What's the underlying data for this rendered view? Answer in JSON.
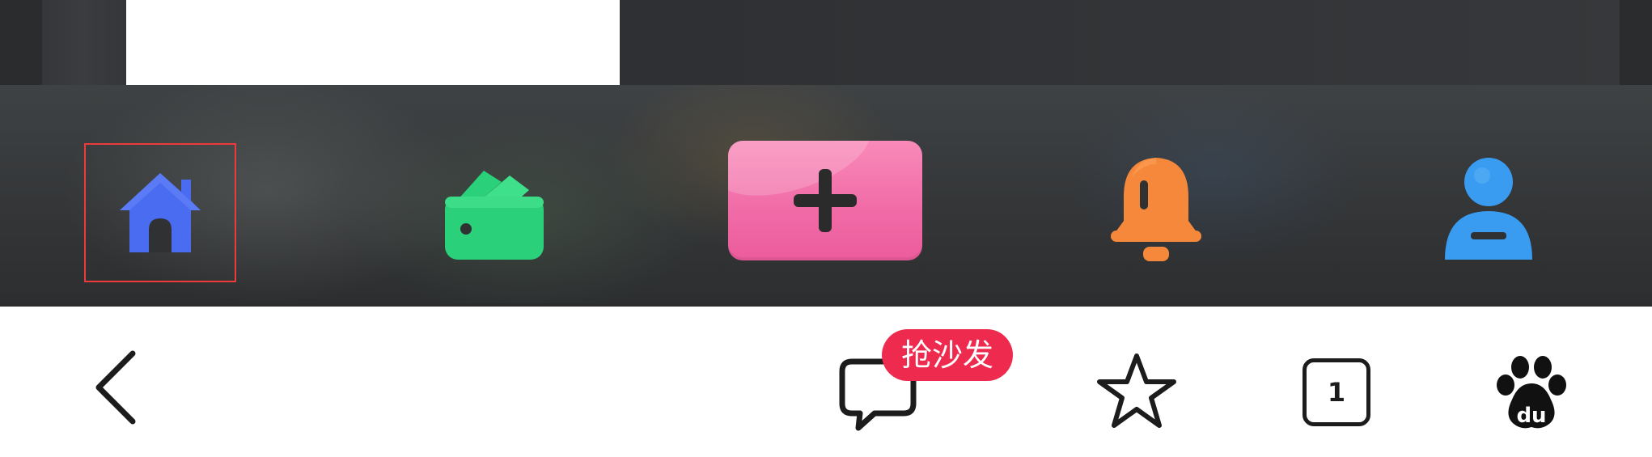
{
  "colors": {
    "home_icon": "#4a6cf0",
    "wallet_icon": "#2bd07a",
    "add_button": "#f06aa6",
    "bell_icon": "#f5883a",
    "user_icon": "#3a9cf0",
    "selection_box": "#ee3a3a",
    "badge": "#ee2b4e"
  },
  "tabbar": {
    "items": [
      {
        "icon": "home-icon"
      },
      {
        "icon": "wallet-icon"
      },
      {
        "icon": "plus-icon"
      },
      {
        "icon": "bell-icon"
      },
      {
        "icon": "user-icon"
      }
    ]
  },
  "browser_bar": {
    "comment_badge": "抢沙发",
    "tab_count": "1",
    "baidu_text": "du",
    "icons": [
      "back-arrow-icon",
      "comment-icon",
      "star-icon",
      "tabs-icon",
      "baidu-paw-icon"
    ]
  }
}
